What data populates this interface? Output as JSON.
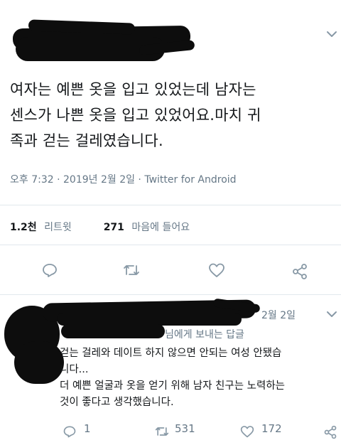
{
  "tweet": {
    "text_lines": [
      "여자는 예쁜 옷을 입고 있었는데 남자는",
      "센스가 나쁜 옷을 입고 있었어요.마치 귀",
      "족과 걷는 걸레였습니다."
    ],
    "meta": "오후 7:32 · 2019년 2월 2일 · Twitter for Android",
    "retweet_count": "1.2천",
    "retweet_label": "리트윗",
    "like_count": "271",
    "like_label": "마음에 들어요"
  },
  "reply": {
    "date": "2월 2일",
    "reply_to_visible": "님에게 보내는 답글",
    "body_lines": [
      "걷는 걸레와 데이트 하지 않으면 안되는 여성 안됐습",
      "니다...",
      "더 예쁜 얼굴과 옷을 얻기 위해 남자 친구는 노력하는",
      "것이 좋다고 생각했습니다."
    ],
    "reply_count": "1",
    "retweet_count": "531",
    "like_count": "172"
  },
  "icons": {
    "chevron": "chevron-down-icon",
    "reply": "reply-icon",
    "retweet": "retweet-icon",
    "like": "heart-icon",
    "share": "share-icon"
  },
  "colors": {
    "text": "#14171a",
    "muted": "#657786",
    "divider": "#e1e8ed",
    "redaction": "#0d0d0d"
  }
}
